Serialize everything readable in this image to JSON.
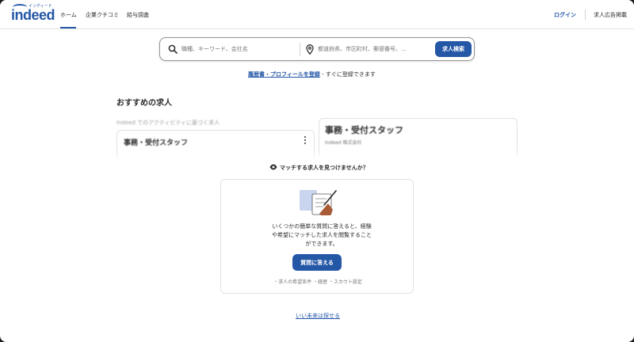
{
  "brand": {
    "logo_text": "indeed",
    "logo_kana": "インディード",
    "color": "#2557a7"
  },
  "header": {
    "nav": [
      "ホーム",
      "企業クチコミ",
      "給与調査"
    ],
    "login": "ログイン",
    "employer": "求人広告掲載"
  },
  "search": {
    "what_placeholder": "職種、キーワード、会社名",
    "where_placeholder": "都道府県、市区町村、郵便番号、...",
    "button": "求人検索"
  },
  "resume": {
    "link": "履歴書・プロフィールを登録",
    "suffix": " - すぐに登録できます"
  },
  "recommended": {
    "title": "おすすめの求人",
    "activity_label": "Indeed でのアクティビティに基づく求人",
    "jobs": [
      {
        "title": "事務・受付スタッフ"
      },
      {
        "title": "事務・受付スタッフ",
        "company": "Indeed 株式会社"
      }
    ]
  },
  "prompt": {
    "heading": "マッチする求人を見つけませんか？",
    "body": "いくつかの簡単な質問に答えると、経験や希望にマッチした求人を閲覧することができます。",
    "button": "質問に答える",
    "tags": "・求人の希望条件 ・経歴 ・スカウト設定"
  },
  "footer": {
    "link": "いい未来は探せる"
  }
}
